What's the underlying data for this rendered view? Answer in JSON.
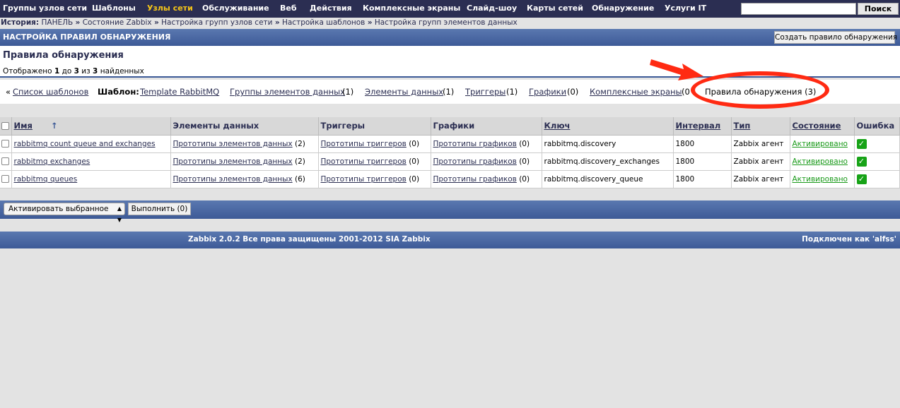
{
  "topmenu": {
    "items": [
      "Группы узлов сети",
      "Шаблоны",
      "Узлы сети",
      "Обслуживание",
      "Веб",
      "Действия",
      "Комплексные экраны",
      "Слайд-шоу",
      "Карты сетей",
      "Обнаружение",
      "Услуги IT"
    ],
    "active": "Узлы сети",
    "search_button": "Поиск",
    "search_value": ""
  },
  "history": {
    "label": "История:",
    "links": [
      "ПАНЕЛЬ",
      "Состояние Zabbix",
      "Настройка групп узлов сети",
      "Настройка шаблонов",
      "Настройка групп элементов данных"
    ],
    "separator": "»"
  },
  "header": {
    "title": "НАСТРОЙКА ПРАВИЛ ОБНАРУЖЕНИЯ",
    "create_button": "Создать правило обнаружения"
  },
  "panel": {
    "title": "Правила обнаружения",
    "count_prefix": "Отображено",
    "from": "1",
    "to_word": "до",
    "to": "3",
    "of_word": "из",
    "total": "3",
    "found_word": "найденных"
  },
  "tabs": {
    "lead": "«",
    "template_list": "Список шаблонов",
    "template_label": "Шаблон:",
    "template_name": "Template RabbitMQ",
    "item_groups": "Группы элементов данных",
    "item_groups_count": "(1)",
    "items": "Элементы данных",
    "items_count": "(1)",
    "triggers": "Триггеры",
    "triggers_count": "(1)",
    "graphs": "Графики",
    "graphs_count": "(0)",
    "screens": "Комплексные экраны",
    "screens_count": "(0",
    "discovery": "Правила обнаружения (3)"
  },
  "table": {
    "columns": [
      "Имя",
      "Элементы данных",
      "Триггеры",
      "Графики",
      "Ключ",
      "Интервал",
      "Тип",
      "Состояние",
      "Ошибка"
    ],
    "sort_arrow": "↑",
    "rows": [
      {
        "name": "rabbitmq count queue and exchanges",
        "items": "Прототипы элементов данных",
        "items_count": "(2)",
        "triggers": "Прототипы триггеров",
        "triggers_count": "(0)",
        "graphs": "Прототипы графиков",
        "graphs_count": "(0)",
        "key": "rabbitmq.discovery",
        "interval": "1800",
        "type": "Zabbix агент",
        "status": "Активировано"
      },
      {
        "name": "rabbitmq exchanges",
        "items": "Прототипы элементов данных",
        "items_count": "(2)",
        "triggers": "Прототипы триггеров",
        "triggers_count": "(0)",
        "graphs": "Прототипы графиков",
        "graphs_count": "(0)",
        "key": "rabbitmq.discovery_exchanges",
        "interval": "1800",
        "type": "Zabbix агент",
        "status": "Активировано"
      },
      {
        "name": "rabbitmq queues",
        "items": "Прототипы элементов данных",
        "items_count": "(6)",
        "triggers": "Прототипы триггеров",
        "triggers_count": "(0)",
        "graphs": "Прототипы графиков",
        "graphs_count": "(0)",
        "key": "rabbitmq.discovery_queue",
        "interval": "1800",
        "type": "Zabbix агент",
        "status": "Активировано"
      }
    ]
  },
  "actions": {
    "select_value": "Активировать выбранное",
    "execute_button": "Выполнить (0)"
  },
  "footer": {
    "copyright": "Zabbix 2.0.2 Все права защищены 2001-2012 SIA Zabbix",
    "user": "Подключен как 'alfss'"
  },
  "colors": {
    "topmenu_bg": "#2b2e52",
    "active_menu": "#f5c518",
    "header_blue": "#3d5a97",
    "annotation_red": "#ff2a12",
    "status_green": "#1a9a1a"
  }
}
